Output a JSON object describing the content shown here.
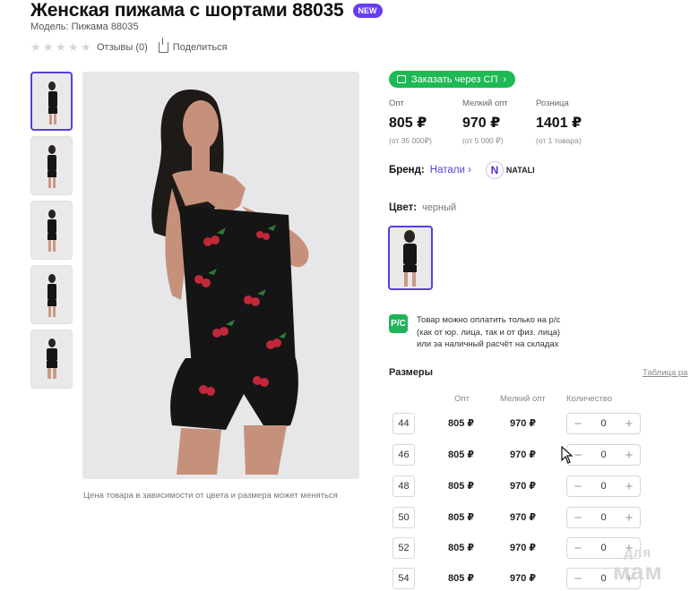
{
  "product": {
    "title": "Женская пижама с шортами 88035",
    "badge": "NEW",
    "model": "Модель: Пижама 88035",
    "reviews": "Отзывы (0)",
    "share": "Поделиться"
  },
  "gallery": {
    "thumb_count": 5,
    "caption": "Цена товара в зависимости от цвета и размера может меняться"
  },
  "order_button": "Заказать через СП",
  "prices": [
    {
      "label": "Опт",
      "value": "805 ₽",
      "sub": "(от 35 000₽)"
    },
    {
      "label": "Мелкий опт",
      "value": "970 ₽",
      "sub": "(от 5 000 ₽)"
    },
    {
      "label": "Розница",
      "value": "1401 ₽",
      "sub": "(от 1 товара)"
    }
  ],
  "brand": {
    "label": "Бренд:",
    "link": "Натали",
    "logo_letter": "N",
    "logo_text": "NATALI"
  },
  "color": {
    "label": "Цвет:",
    "value": "черный"
  },
  "payment": {
    "icon": "Р/С",
    "lines": [
      "Товар можно оплатить только на р/с",
      "(как от юр. лица, так и от физ. лица)",
      "или за наличный расчёт на складах"
    ]
  },
  "sizes": {
    "title": "Размеры",
    "table_link": "Таблица ра",
    "headers": {
      "opt": "Опт",
      "small": "Мелкий опт",
      "qty": "Количество"
    },
    "rows": [
      {
        "size": "44",
        "opt": "805 ₽",
        "small": "970 ₽",
        "qty": "0"
      },
      {
        "size": "46",
        "opt": "805 ₽",
        "small": "970 ₽",
        "qty": "0"
      },
      {
        "size": "48",
        "opt": "805 ₽",
        "small": "970 ₽",
        "qty": "0"
      },
      {
        "size": "50",
        "opt": "805 ₽",
        "small": "970 ₽",
        "qty": "0"
      },
      {
        "size": "52",
        "opt": "805 ₽",
        "small": "970 ₽",
        "qty": "0"
      },
      {
        "size": "54",
        "opt": "805 ₽",
        "small": "970 ₽",
        "qty": "0"
      }
    ],
    "minus": "−",
    "plus": "+"
  },
  "watermark": {
    "line1": "для",
    "line2": "мам"
  },
  "colors": {
    "accent": "#5b3fd6",
    "green": "#1db954",
    "badge": "#6a3cf0"
  }
}
